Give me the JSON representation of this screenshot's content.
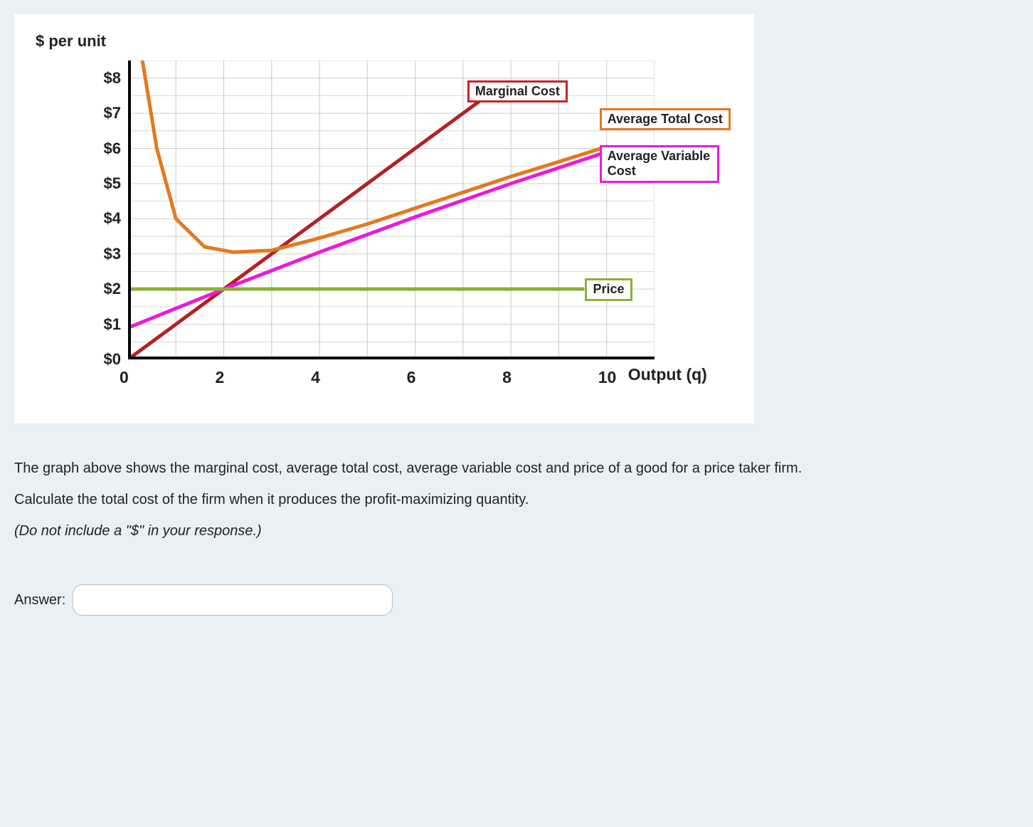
{
  "chart_data": {
    "type": "line",
    "ylabel": "$ per unit",
    "xlabel": "Output (q)",
    "x_ticks": [
      0,
      2,
      4,
      6,
      8,
      10
    ],
    "y_ticks": [
      "$0",
      "$1",
      "$2",
      "$3",
      "$4",
      "$5",
      "$6",
      "$7",
      "$8"
    ],
    "xlim": [
      0,
      11
    ],
    "ylim": [
      0,
      8.5
    ],
    "series": [
      {
        "name": "Marginal Cost",
        "color": "#b22222",
        "points": [
          [
            0,
            0
          ],
          [
            1,
            1
          ],
          [
            2,
            2
          ],
          [
            3,
            3
          ],
          [
            4,
            4
          ],
          [
            5,
            5
          ],
          [
            6,
            6
          ],
          [
            7,
            7
          ],
          [
            7.5,
            7.5
          ]
        ]
      },
      {
        "name": "Average Total Cost",
        "color": "#e27a1e",
        "points": [
          [
            0.3,
            8.5
          ],
          [
            0.6,
            6.0
          ],
          [
            1.0,
            4.0
          ],
          [
            1.6,
            3.2
          ],
          [
            2.2,
            3.05
          ],
          [
            3,
            3.1
          ],
          [
            4,
            3.45
          ],
          [
            5,
            3.85
          ],
          [
            6,
            4.3
          ],
          [
            7,
            4.75
          ],
          [
            8,
            5.2
          ],
          [
            9,
            5.62
          ],
          [
            10,
            6.05
          ]
        ]
      },
      {
        "name": "Average Variable Cost",
        "color": "#e81bdc",
        "points": [
          [
            0,
            0.9
          ],
          [
            2,
            2.0
          ],
          [
            4,
            3.05
          ],
          [
            6,
            4.05
          ],
          [
            8,
            5.0
          ],
          [
            10,
            5.9
          ]
        ]
      },
      {
        "name": "Price",
        "color": "#8fae3a",
        "points": [
          [
            0,
            2
          ],
          [
            9.5,
            2
          ]
        ]
      }
    ],
    "legend": [
      {
        "label": "Marginal Cost",
        "color": "#ca2222"
      },
      {
        "label": "Average Total Cost",
        "color": "#e27a1e"
      },
      {
        "label": "Average Variable Cost",
        "color": "#e81bdc"
      },
      {
        "label": "Price",
        "color": "#8fae3a"
      }
    ]
  },
  "question": {
    "p1": "The graph above shows the marginal cost, average total cost, average variable cost and price of a good for a price taker firm.",
    "p2": "Calculate the total cost of the firm when it produces the profit-maximizing quantity.",
    "p3": "(Do not include a \"$\" in your response.)",
    "answer_label": "Answer:",
    "answer_value": ""
  }
}
